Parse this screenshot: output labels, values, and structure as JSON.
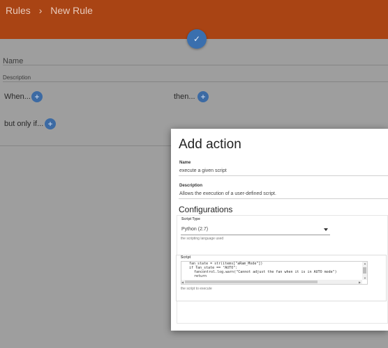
{
  "header": {
    "breadcrumb_root": "Rules",
    "breadcrumb_sep": "›",
    "breadcrumb_current": "New Rule",
    "save_icon": "check-icon"
  },
  "rule_form": {
    "name_label": "Name",
    "description_label": "Description",
    "when_label": "When...",
    "then_label": "then...",
    "only_if_label": "but only if..."
  },
  "dialog": {
    "title": "Add action",
    "name_label": "Name",
    "name_value": "execute a given script",
    "description_label": "Description",
    "description_value": "Allows the execution of a user-defined script.",
    "configurations_title": "Configurations",
    "script_type_label": "Script Type",
    "script_type_value": "Python (2.7)",
    "script_type_helper": "the scripting language used",
    "script_label": "Script",
    "script_lines": [
      "fan_state = str(items[\"aRam_Mode\"])",
      "if fan_state == \"AUTO\":",
      "fancontrol.log.warn(\"Cannot adjust the fan when it is in AUTO mode\")",
      "return"
    ],
    "script_helper": "the script to execute"
  },
  "colors": {
    "header": "#a94414",
    "accent": "#3a6fae",
    "overlay": "#9e9e9e"
  }
}
